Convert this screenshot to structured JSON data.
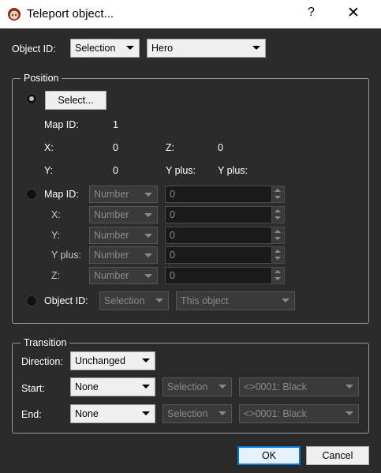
{
  "window": {
    "title": "Teleport object...",
    "help_glyph": "?",
    "close_glyph": "✕",
    "icon": "character-face-icon"
  },
  "object_id": {
    "label": "Object ID:",
    "source": "Selection",
    "value": "Hero"
  },
  "position": {
    "title": "Position",
    "select_button": "Select...",
    "map_id_label": "Map ID:",
    "map_id_value": "1",
    "x_label": "X:",
    "x_value": "0",
    "z_label": "Z:",
    "z_value": "0",
    "y_label": "Y:",
    "y_value": "0",
    "yplus_label": "Y plus:",
    "yplus_label2": "Y plus:",
    "manual": {
      "map_id": {
        "label": "Map ID:",
        "type": "Number",
        "value": "0"
      },
      "x": {
        "label": "X:",
        "type": "Number",
        "value": "0"
      },
      "y": {
        "label": "Y:",
        "type": "Number",
        "value": "0"
      },
      "yplus": {
        "label": "Y plus:",
        "type": "Number",
        "value": "0"
      },
      "z": {
        "label": "Z:",
        "type": "Number",
        "value": "0"
      }
    },
    "object_id_label": "Object ID:",
    "object_source": "Selection",
    "object_value": "This object"
  },
  "transition": {
    "title": "Transition",
    "direction_label": "Direction:",
    "direction_value": "Unchanged",
    "start_label": "Start:",
    "start_value": "None",
    "start_source": "Selection",
    "start_color": "<>0001: Black",
    "end_label": "End:",
    "end_value": "None",
    "end_source": "Selection",
    "end_color": "<>0001: Black"
  },
  "buttons": {
    "ok": "OK",
    "cancel": "Cancel"
  },
  "colors": {
    "background": "#2b2b2b",
    "focus": "#0078d7"
  }
}
